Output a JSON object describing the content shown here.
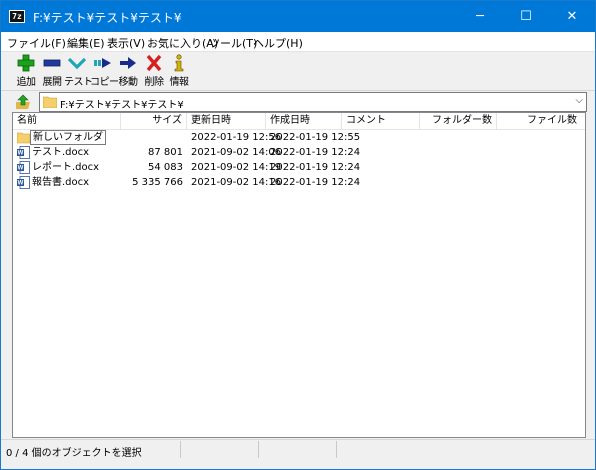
{
  "window": {
    "app_icon": "7z",
    "title": "F:¥テスト¥テスト¥テスト¥"
  },
  "window_controls": {
    "minimize": "─",
    "maximize": "☐",
    "close": "✕"
  },
  "menu": [
    "ファイル(F)",
    "編集(E)",
    "表示(V)",
    "お気に入り(A)",
    "ツール(T)",
    "ヘルプ(H)"
  ],
  "toolbar": {
    "add": "追加",
    "extract": "展開",
    "test": "テスト",
    "copy": "コピー",
    "move": "移動",
    "delete": "削除",
    "info": "情報"
  },
  "address": {
    "path": "F:¥テスト¥テスト¥テスト¥"
  },
  "columns": {
    "name": "名前",
    "size": "サイズ",
    "modified": "更新日時",
    "created": "作成日時",
    "comment": "コメント",
    "folders": "フォルダー数",
    "files": "ファイル数"
  },
  "files": [
    {
      "name": "新しいフォルダ",
      "size": "",
      "modified": "2022-01-19 12:56",
      "created": "2022-01-19 12:55",
      "type": "folder"
    },
    {
      "name": "テスト.docx",
      "size": "87 801",
      "modified": "2021-09-02 14:06",
      "created": "2022-01-19 12:24",
      "type": "word"
    },
    {
      "name": "レポート.docx",
      "size": "54 083",
      "modified": "2021-09-02 14:19",
      "created": "2022-01-19 12:24",
      "type": "word"
    },
    {
      "name": "報告書.docx",
      "size": "5 335 766",
      "modified": "2021-09-02 14:16",
      "created": "2022-01-19 12:24",
      "type": "word"
    }
  ],
  "status": {
    "selection": "0 / 4 個のオブジェクトを選択"
  },
  "colors": {
    "titlebar": "#0078d7",
    "add": "#1aa31a",
    "extract": "#1d3a9e",
    "test": "#1fa7b8",
    "move": "#1a2a8a",
    "delete": "#d81e1e",
    "info": "#d9b100"
  }
}
